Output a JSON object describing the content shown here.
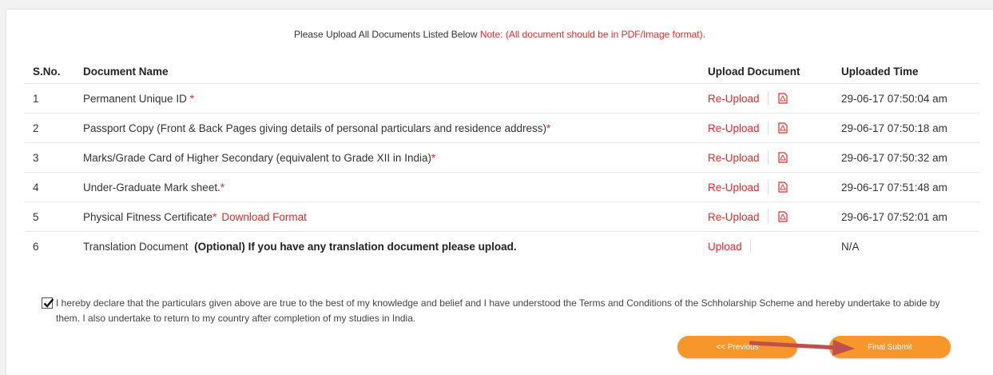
{
  "notice": {
    "text": "Please Upload All Documents Listed Below",
    "note": "Note: (All document should be in PDF/Image format)."
  },
  "table": {
    "headers": [
      "S.No.",
      "Document Name",
      "Upload Document",
      "Uploaded Time"
    ],
    "rows": [
      {
        "sno": "1",
        "name": "Permanent Unique ID",
        "req": " *",
        "extra": "",
        "optional": "",
        "action": "Re-Upload",
        "time": "29-06-17 07:50:04 am"
      },
      {
        "sno": "2",
        "name": "Passport Copy (Front & Back Pages giving details of personal particulars and residence address)",
        "req": "*",
        "extra": "",
        "optional": "",
        "action": "Re-Upload",
        "time": "29-06-17 07:50:18 am"
      },
      {
        "sno": "3",
        "name": "Marks/Grade Card of Higher Secondary (equivalent to Grade XII in India)",
        "req": "*",
        "extra": "",
        "optional": "",
        "action": "Re-Upload",
        "time": "29-06-17 07:50:32 am"
      },
      {
        "sno": "4",
        "name": "Under-Graduate Mark sheet.",
        "req": "*",
        "extra": "",
        "optional": "",
        "action": "Re-Upload",
        "time": "29-06-17 07:51:48 am"
      },
      {
        "sno": "5",
        "name": "Physical Fitness Certificate",
        "req": "*",
        "extra": "Download Format",
        "optional": "",
        "action": "Re-Upload",
        "time": "29-06-17 07:52:01 am"
      },
      {
        "sno": "6",
        "name": "Translation Document",
        "req": "",
        "extra": "",
        "optional": "(Optional) If you have any translation document please upload.",
        "action": "Upload",
        "time": "N/A"
      }
    ]
  },
  "declaration": {
    "checked": true,
    "text": "I hereby declare that the particulars given above are true to the best of my knowledge and belief and I have understood the Terms and Conditions of the Schholarship Scheme and hereby undertake to abide by them. I also undertake to return to my country after completion of my studies in India."
  },
  "buttons": {
    "previous": "<< Previous",
    "submit": "Final Submit"
  },
  "colors": {
    "accent": "#e8272b",
    "button": "#f7962b",
    "arrow": "#c0504d"
  },
  "icons": {
    "pdf": "pdf-file-icon",
    "check": "check-icon",
    "arrow": "annotation-arrow"
  }
}
